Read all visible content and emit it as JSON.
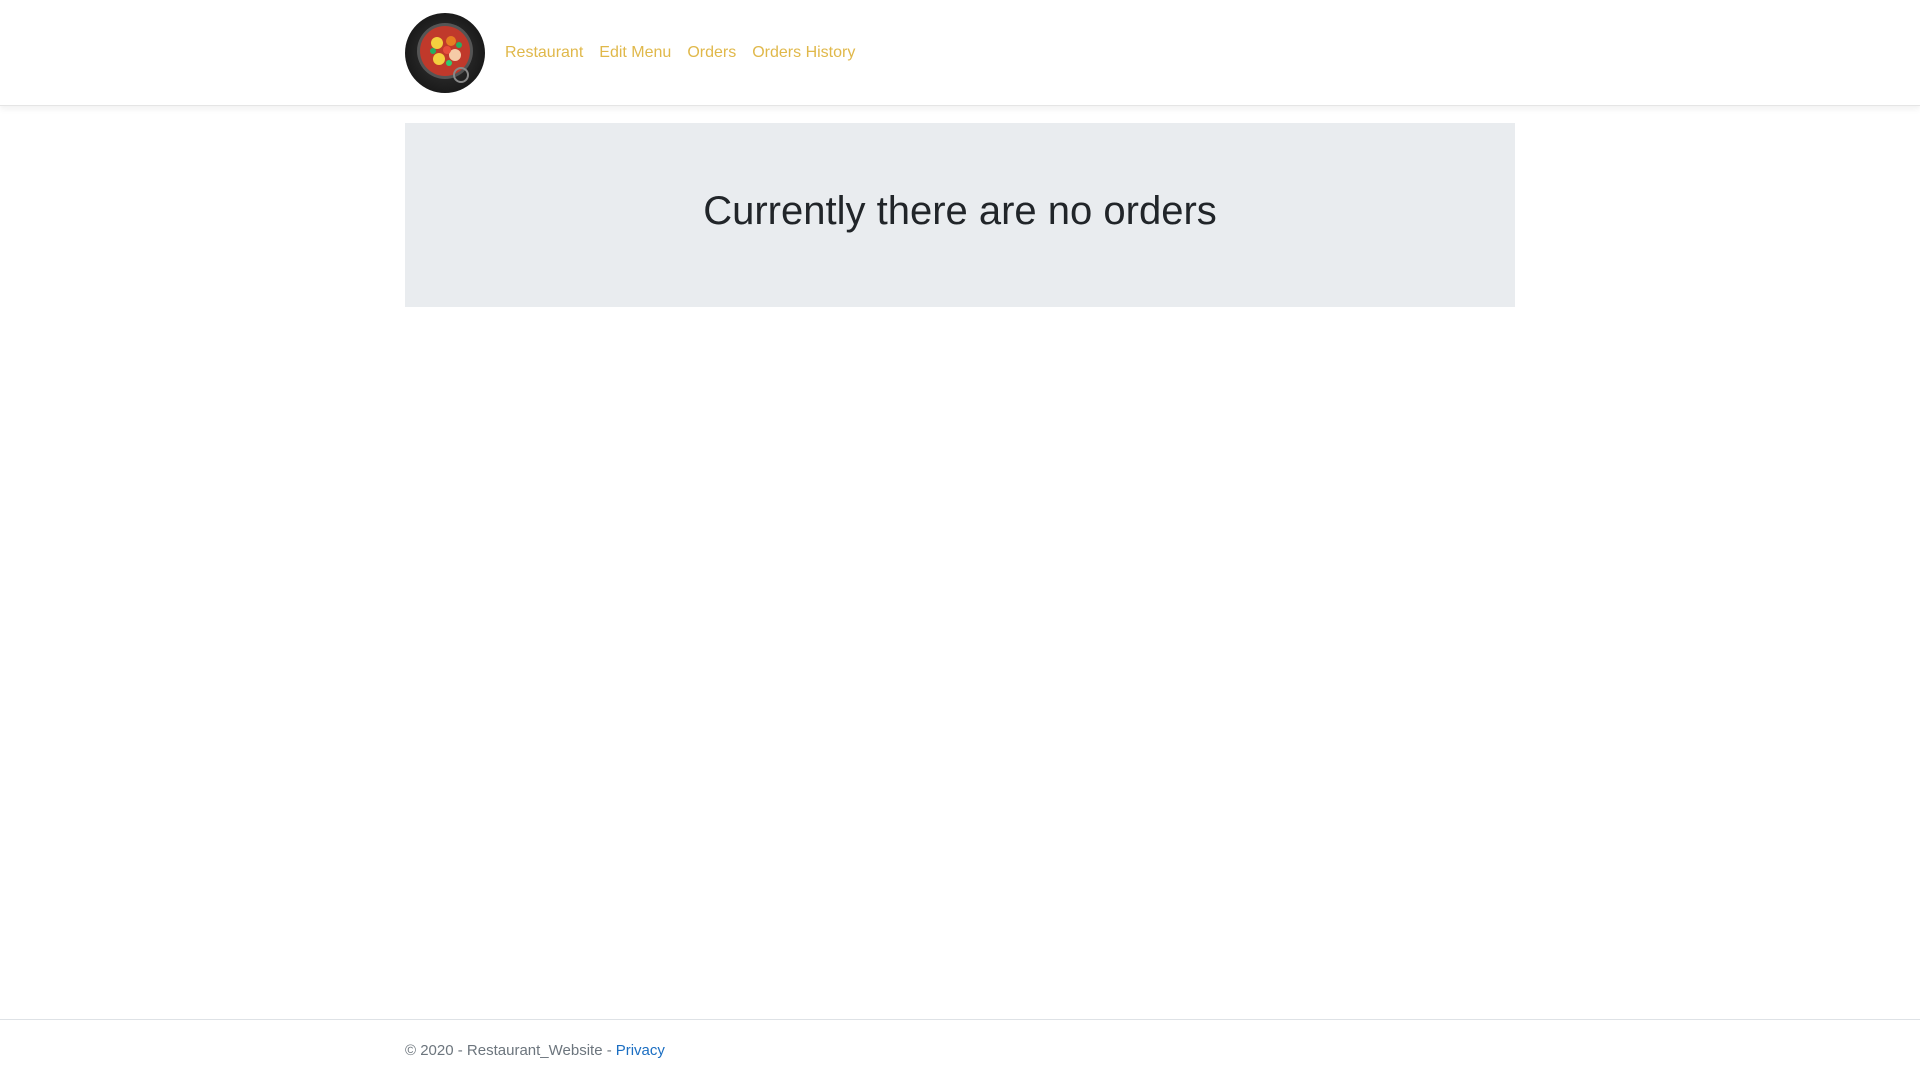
{
  "navbar": {
    "logo_icon": "food-bowl-logo-icon",
    "links": [
      {
        "label": "Restaurant"
      },
      {
        "label": "Edit Menu"
      },
      {
        "label": "Orders"
      },
      {
        "label": "Orders History"
      }
    ],
    "link_color": "#e0b84a"
  },
  "main": {
    "message": "Currently there are no orders",
    "panel_color": "#e9ecef"
  },
  "footer": {
    "copyright": "© 2020 - Restaurant_Website -",
    "privacy_label": "Privacy",
    "privacy_color": "#1b6ec2"
  }
}
